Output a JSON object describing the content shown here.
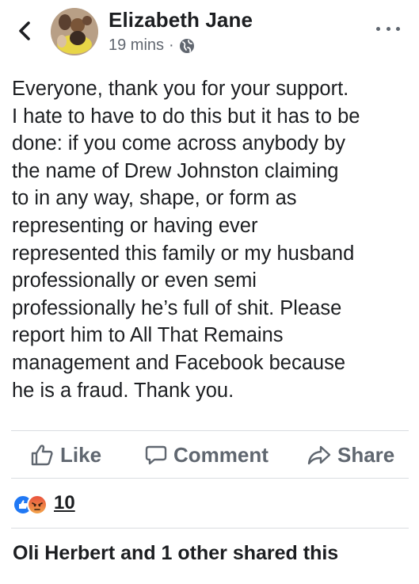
{
  "post": {
    "author": "Elizabeth Jane",
    "time": "19 mins",
    "separator": "·",
    "privacy_icon": "globe-icon",
    "text": "Everyone, thank you for your support.\nI hate to have to do this but it has to be\ndone: if you come across anybody by\nthe name of Drew Johnston claiming\nto in any way, shape, or form as\nrepresenting or having ever\nrepresented this family or my husband\nprofessionally or even semi\nprofessionally he’s full of shit. Please\nreport him to All That Remains\nmanagement and Facebook because\nhe is a fraud.  Thank you."
  },
  "actions": {
    "like": "Like",
    "comment": "Comment",
    "share": "Share"
  },
  "reactions": {
    "count": "10",
    "types": [
      "like",
      "angry"
    ]
  },
  "shares": {
    "text": "Oli Herbert and 1 other shared this"
  },
  "colors": {
    "text": "#1c1e21",
    "muted": "#606770",
    "like_blue": "#2078f4",
    "divider": "#dadde1"
  }
}
